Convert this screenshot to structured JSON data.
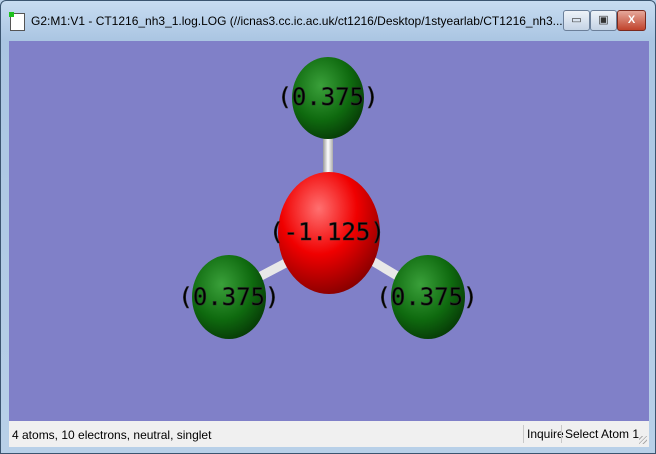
{
  "window": {
    "title": "G2:M1:V1 - CT1216_nh3_1.log.LOG (//icnas3.cc.ic.ac.uk/ct1216/Desktop/1styearlab/CT1216_nh3...",
    "minimize_label": "▭",
    "maximize_label": "▣",
    "close_label": "X"
  },
  "molecule": {
    "background_color": "#8080c8",
    "atoms": [
      {
        "element": "H",
        "charge_label": "(0.375)",
        "color": "#0f6a0f"
      },
      {
        "element": "N",
        "charge_label": "(-1.125)",
        "color": "#ff0000"
      },
      {
        "element": "H",
        "charge_label": "(0.375)",
        "color": "#0f6a0f"
      },
      {
        "element": "H",
        "charge_label": "(0.375)",
        "color": "#0f6a0f"
      }
    ]
  },
  "statusbar": {
    "info": "4 atoms, 10 electrons, neutral, singlet",
    "mode": "Inquire",
    "action": "Select Atom 1"
  }
}
